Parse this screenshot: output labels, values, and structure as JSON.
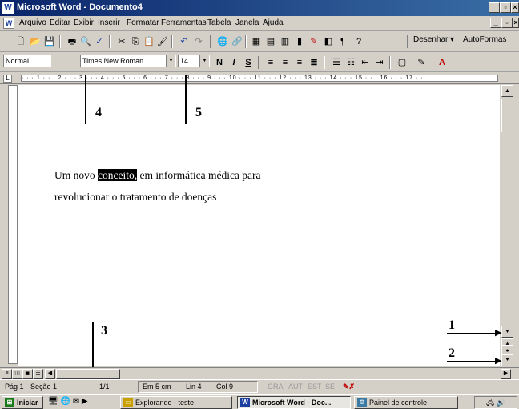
{
  "window": {
    "title": "Microsoft Word - Documento4"
  },
  "menu": [
    "Arquivo",
    "Editar",
    "Exibir",
    "Inserir",
    "Formatar",
    "Ferramentas",
    "Tabela",
    "Janela",
    "Ajuda"
  ],
  "formatting": {
    "style": "Normal",
    "font": "Times New Roman",
    "size": "14"
  },
  "drawing_toolbar": {
    "draw": "Desenhar",
    "autoshapes": "AutoFormas"
  },
  "document": {
    "line1_before": "Um novo ",
    "line1_selected": "conceito,",
    "line1_after": " em informática médica para",
    "line2": "revolucionar o tratamento de doenças"
  },
  "annotations": [
    "1",
    "2",
    "3",
    "4",
    "5"
  ],
  "status": {
    "page": "Pág 1",
    "section": "Seção 1",
    "pages": "1/1",
    "at": "Em 5 cm",
    "line": "Lin 4",
    "col": "Col 9",
    "modes": [
      "GRA",
      "AUT",
      "EST",
      "SE"
    ]
  },
  "taskbar": {
    "start": "Iniciar",
    "buttons": [
      "Explorando - teste",
      "Microsoft Word - Doc...",
      "Painel de controle"
    ]
  },
  "icons": {
    "new": "new-document-icon",
    "open": "open-folder-icon",
    "save": "save-icon",
    "print": "print-icon",
    "preview": "print-preview-icon",
    "spell": "spelling-icon"
  }
}
